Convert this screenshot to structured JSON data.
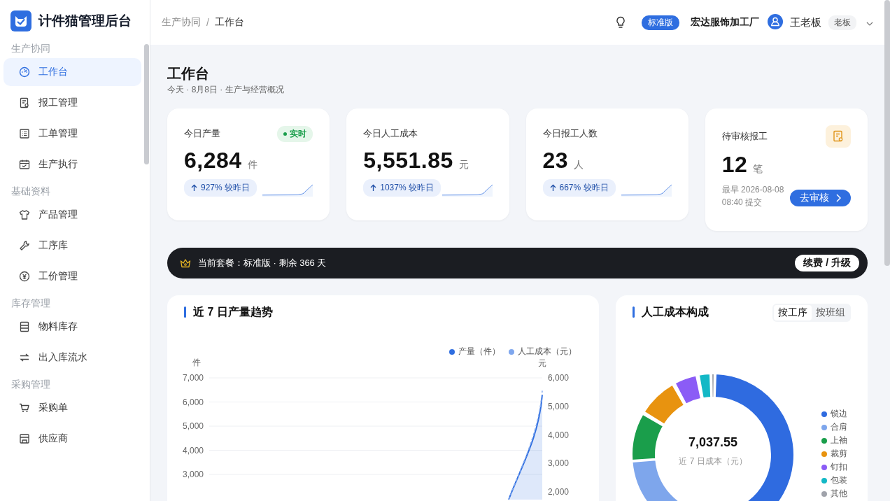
{
  "app": {
    "title": "计件猫管理后台"
  },
  "sidebar": {
    "groups": [
      {
        "label": "生产协同",
        "items": [
          {
            "label": "工作台",
            "kind": "gauge",
            "selected": true
          },
          {
            "label": "报工管理",
            "kind": "report",
            "selected": false
          },
          {
            "label": "工单管理",
            "kind": "list",
            "selected": false
          },
          {
            "label": "生产执行",
            "kind": "calendar",
            "selected": false
          }
        ]
      },
      {
        "label": "基础资料",
        "items": [
          {
            "label": "产品管理",
            "kind": "shirt",
            "selected": false
          },
          {
            "label": "工序库",
            "kind": "wrench",
            "selected": false
          },
          {
            "label": "工价管理",
            "kind": "yen",
            "selected": false
          }
        ]
      },
      {
        "label": "库存管理",
        "items": [
          {
            "label": "物料库存",
            "kind": "cabinet",
            "selected": false
          },
          {
            "label": "出入库流水",
            "kind": "swap",
            "selected": false
          }
        ]
      },
      {
        "label": "采购管理",
        "items": [
          {
            "label": "采购单",
            "kind": "cart",
            "selected": false
          },
          {
            "label": "供应商",
            "kind": "store",
            "selected": false
          }
        ]
      }
    ]
  },
  "header": {
    "breadcrumb": [
      "生产协同",
      "工作台"
    ],
    "separator": "/",
    "plan": "标准版",
    "company": "宏达服饰加工厂",
    "user": "王老板",
    "role": "老板"
  },
  "page": {
    "title": "工作台",
    "subtitle": "今天 · 8月8日 · 生产与经营概况"
  },
  "kpis": [
    {
      "kind": "stat",
      "label": "今日产量",
      "badge": "实时",
      "value": "6,284",
      "unit": "件",
      "change": "927% 较昨日"
    },
    {
      "kind": "stat",
      "label": "今日人工成本",
      "value": "5,551.85",
      "unit": "元",
      "change": "1037% 较昨日"
    },
    {
      "kind": "stat",
      "label": "今日报工人数",
      "value": "23",
      "unit": "人",
      "change": "667% 较昨日"
    },
    {
      "kind": "pending",
      "label": "待审核报工",
      "value": "12",
      "unit": "笔",
      "note": "最早 2026-08-08 08:40 提交",
      "action": "去审核"
    }
  ],
  "banner": {
    "text": "当前套餐：标准版 · 剩余 366 天",
    "action": "续费 / 升级"
  },
  "trend": {
    "title": "近 7 日产量趋势",
    "legend": [
      {
        "kind": "solid",
        "label": "产量（件）",
        "color": "#2f6ee0"
      },
      {
        "kind": "dashed",
        "label": "人工成本（元）",
        "color": "#7fa7ee"
      }
    ],
    "left_axis": {
      "label": "件",
      "ticks": [
        "7,000",
        "6,000",
        "5,000",
        "4,000",
        "3,000"
      ]
    },
    "right_axis": {
      "label": "元",
      "ticks": [
        "6,000",
        "5,000",
        "4,000",
        "3,000",
        "2,000"
      ]
    }
  },
  "cost": {
    "title": "人工成本构成",
    "tabs": [
      {
        "label": "按工序",
        "selected": true
      },
      {
        "label": "按班组",
        "selected": false
      }
    ],
    "total": "7,037.55",
    "total_label": "近 7 日成本（元）",
    "legend": [
      {
        "label": "锁边",
        "color": "#2f6be0"
      },
      {
        "label": "合肩",
        "color": "#7ea6ec"
      },
      {
        "label": "上袖",
        "color": "#1a9e4b"
      },
      {
        "label": "裁剪",
        "color": "#e8930f"
      },
      {
        "label": "钉扣",
        "color": "#8b5cf6"
      },
      {
        "label": "包装",
        "color": "#13b8c6"
      },
      {
        "label": "其他",
        "color": "#a0a3ab"
      }
    ]
  }
}
